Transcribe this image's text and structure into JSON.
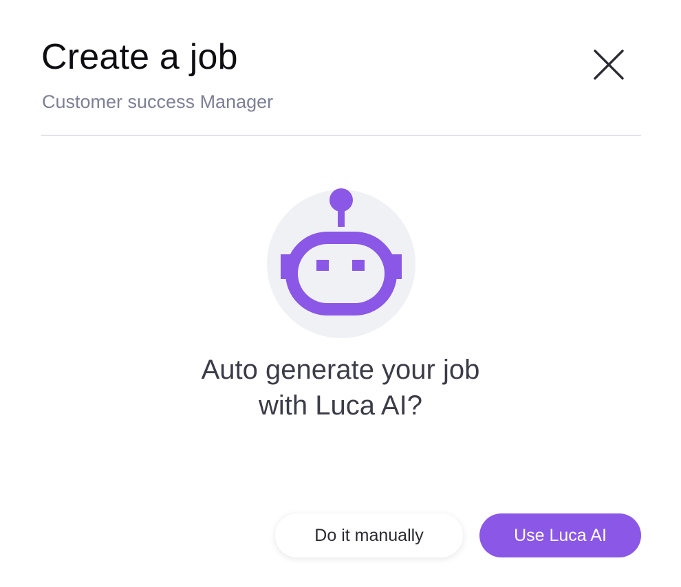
{
  "modal": {
    "title": "Create a job",
    "subtitle": "Customer success Manager",
    "close_icon": "close-icon"
  },
  "illustration": {
    "icon": "robot-icon",
    "accent_color": "#8b57e6",
    "circle_color": "#eff1f5"
  },
  "prompt": {
    "line1": "Auto generate your job",
    "line2": "with Luca AI?"
  },
  "actions": {
    "manual_label": "Do it manually",
    "ai_label": "Use Luca AI",
    "primary_color": "#8b57e6"
  }
}
